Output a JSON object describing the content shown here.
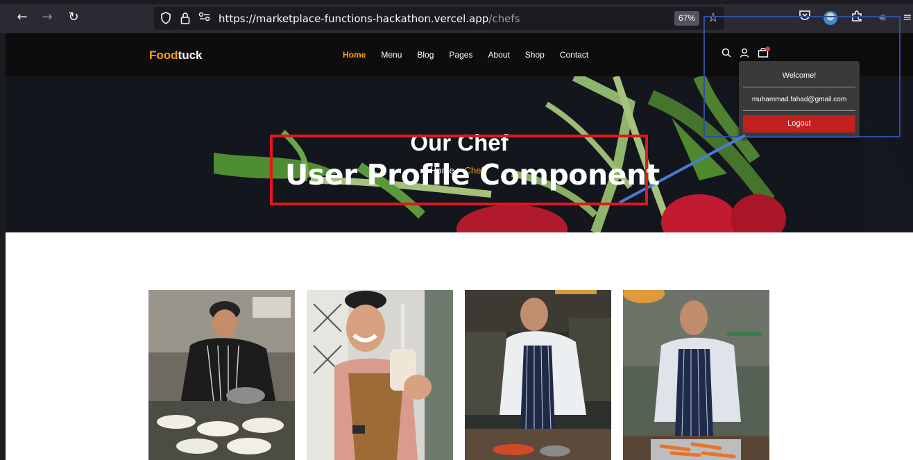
{
  "browser": {
    "url_domain": "https://marketplace-functions-hackathon.vercel.app",
    "url_path": "/chefs",
    "zoom": "67%"
  },
  "site": {
    "logo_part1": "Food",
    "logo_part2": "tuck",
    "menu": [
      "Home",
      "Menu",
      "Blog",
      "Pages",
      "About",
      "Shop",
      "Contact"
    ],
    "active_menu": "Home"
  },
  "hero": {
    "title": "Our Chef",
    "breadcrumb_home": "Home",
    "breadcrumb_sep": ">",
    "breadcrumb_current": "Chef"
  },
  "profile_dropdown": {
    "welcome": "Welcome!",
    "email": "muhammad.fahad@gmail.com",
    "logout_label": "Logout"
  },
  "annotation": {
    "label": "User Profile Component",
    "label_color": "#e4161a",
    "box_color": "#2f4f9c",
    "connector_color": "#4a7bd6"
  },
  "colors": {
    "accent": "#ff9f0d",
    "logout": "#c21f1f"
  },
  "chefs": [
    {
      "image": "chef plating dishes in kitchen"
    },
    {
      "image": "smiling chef holding milkshake"
    },
    {
      "image": "chef chopping at counter"
    },
    {
      "image": "chef cutting carrots"
    }
  ]
}
